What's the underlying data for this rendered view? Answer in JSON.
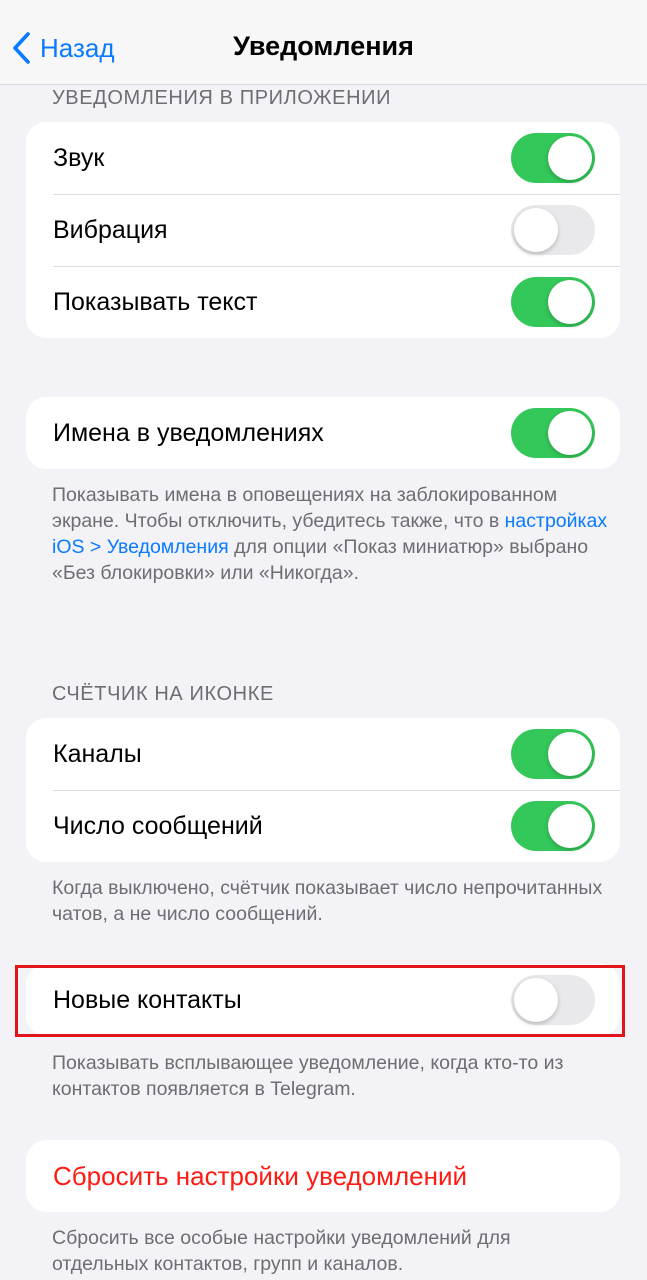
{
  "nav": {
    "back_label": "Назад",
    "title": "Уведомления"
  },
  "in_app": {
    "header": "УВЕДОМЛЕНИЯ В ПРИЛОЖЕНИИ",
    "sound_label": "Звук",
    "sound_on": true,
    "vibration_label": "Вибрация",
    "vibration_on": false,
    "show_text_label": "Показывать текст",
    "show_text_on": true
  },
  "names": {
    "label": "Имена в уведомлениях",
    "on": true,
    "footer_part1": "Показывать имена в оповещениях на заблокированном экране. Чтобы отключить, убедитесь также, что в ",
    "footer_link": "настройках iOS > Уведомления",
    "footer_part2": " для опции «Показ миниатюр» выбрано «Без блокировки» или «Никогда»."
  },
  "badge": {
    "header": "СЧЁТЧИК НА ИКОНКЕ",
    "channels_label": "Каналы",
    "channels_on": true,
    "count_label": "Число сообщений",
    "count_on": true,
    "footer": "Когда выключено, счётчик показывает число непрочитанных чатов, а не число сообщений."
  },
  "new_contacts": {
    "label": "Новые контакты",
    "on": false,
    "footer": "Показывать всплывающее уведомление, когда кто-то из контактов появляется в Telegram."
  },
  "reset": {
    "label": "Сбросить настройки уведомлений",
    "footer": "Сбросить все особые настройки уведомлений для отдельных контактов, групп и каналов."
  },
  "colors": {
    "accent": "#0a7aff",
    "toggle_on": "#34c759",
    "toggle_off": "#e9e9eb",
    "destructive": "#ff1a12",
    "highlight": "#e0141b"
  }
}
